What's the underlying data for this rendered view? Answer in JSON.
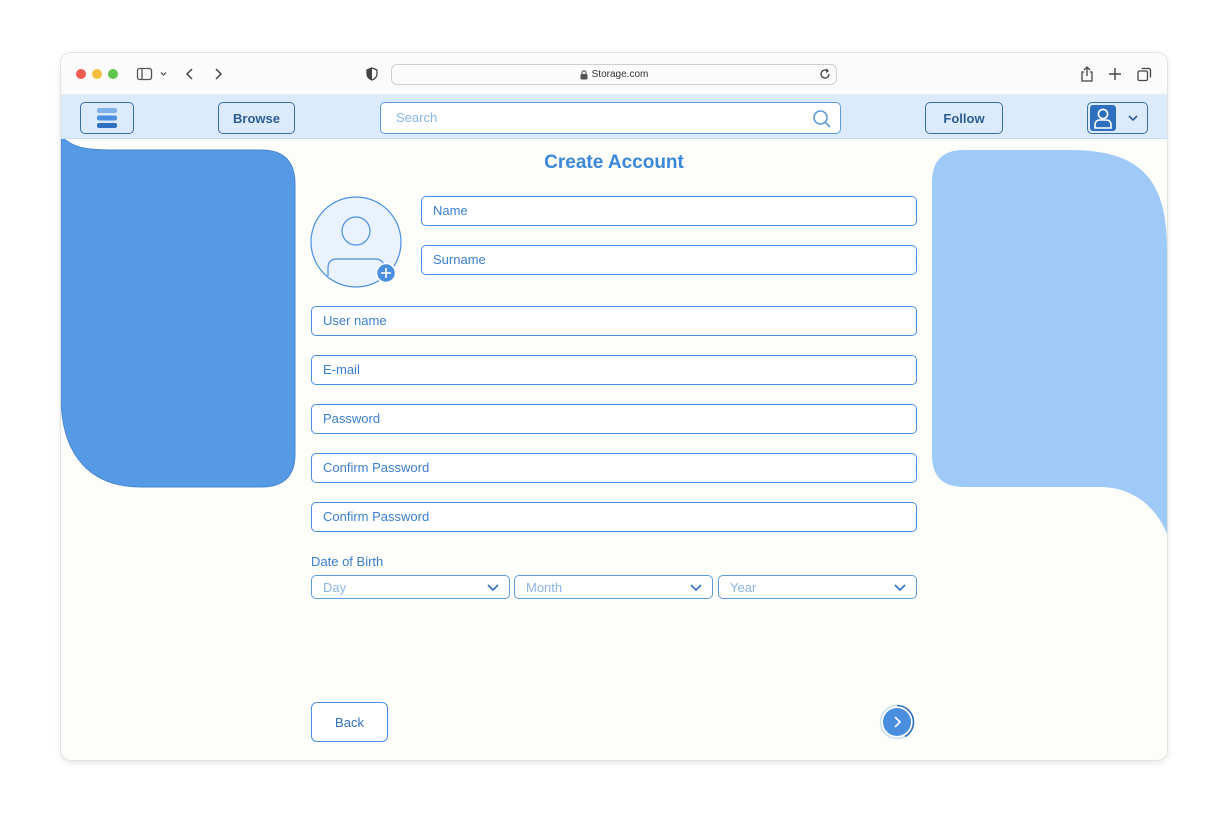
{
  "browser": {
    "url": "Storage.com"
  },
  "header": {
    "browse_label": "Browse",
    "search_placeholder": "Search",
    "follow_label": "Follow"
  },
  "form": {
    "title": "Create Account",
    "name_placeholder": "Name",
    "surname_placeholder": "Surname",
    "username_placeholder": "User name",
    "email_placeholder": "E-mail",
    "password_placeholder": "Password",
    "confirm_password_placeholder": "Confirm Password",
    "confirm_password2_placeholder": "Confirm Password",
    "dob_label": "Date of Birth",
    "day_label": "Day",
    "month_label": "Month",
    "year_label": "Year",
    "back_label": "Back"
  },
  "colors": {
    "accent": "#3b87d8",
    "header_bg": "#dcebfb",
    "panel_left": "#5699e4",
    "panel_right": "#9fcaf8"
  }
}
